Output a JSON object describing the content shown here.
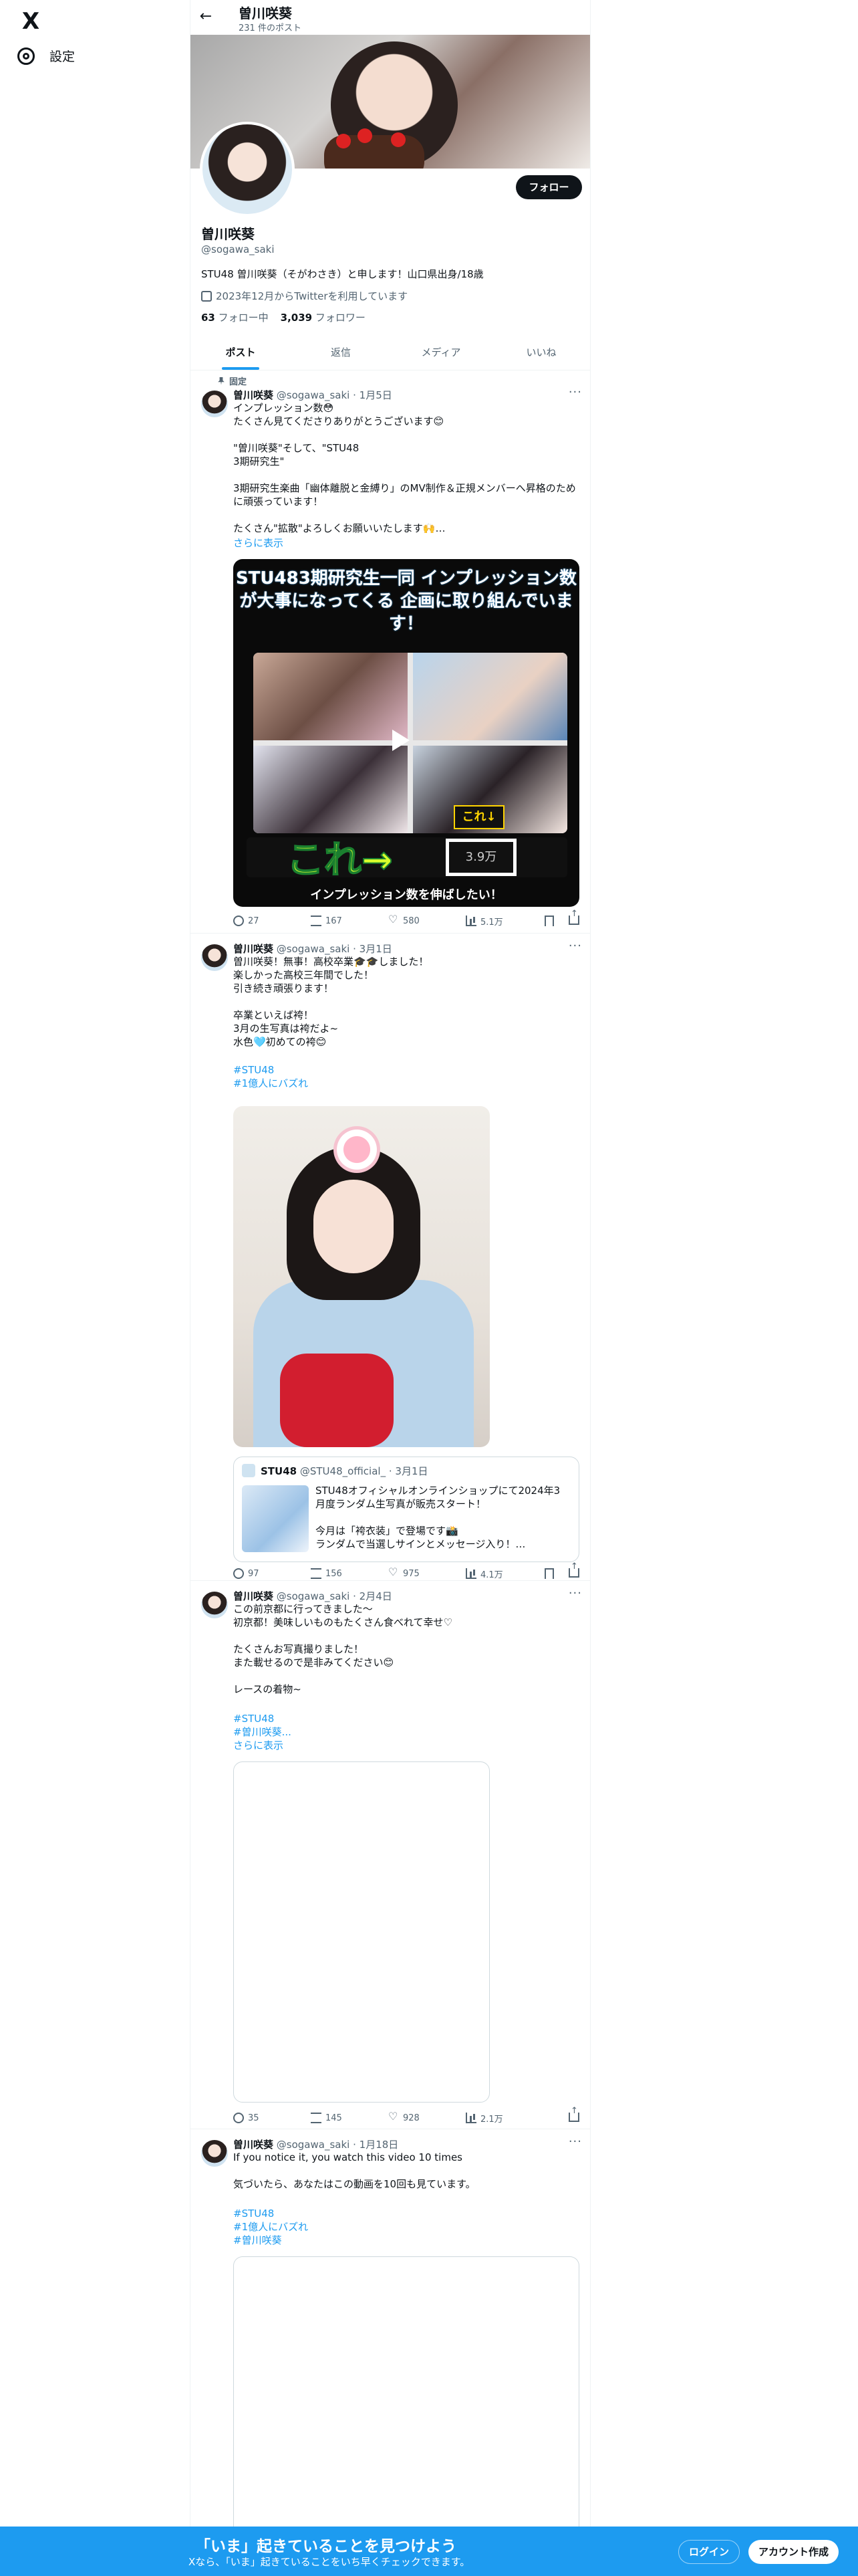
{
  "brand": {
    "logo": "X",
    "accent": "#1d9bf0"
  },
  "sidebar": {
    "settings_label": "設定"
  },
  "header": {
    "name": "曽川咲葵",
    "post_count": "231 件のポスト"
  },
  "profile": {
    "name": "曽川咲葵",
    "handle": "@sogawa_saki",
    "bio": "STU48 曽川咲葵（そがわさき）と申します！山口県出身/18歳",
    "joined": "2023年12月からTwitterを利用しています",
    "following_count": "63",
    "following_label": "フォロー中",
    "followers_count": "3,039",
    "followers_label": "フォロワー",
    "follow_button": "フォロー"
  },
  "tabs": [
    {
      "label": "ポスト"
    },
    {
      "label": "返信"
    },
    {
      "label": "メディア"
    },
    {
      "label": "いいね"
    }
  ],
  "pinned_label": "固定",
  "tweets": [
    {
      "name": "曽川咲葵",
      "handle": "@sogawa_saki",
      "date": "· 1月5日",
      "more": "···",
      "text": "インプレッション数😳\nたくさん見てくださりありがとうございます😊\n\n\"曽川咲葵\"そして、\"STU48\n3期研究生\"\n\n3期研究生楽曲「幽体離脱と金縛り」のMV制作＆正規メンバーへ昇格のために頑張っています！\n\nたくさん\"拡散\"よろしくお願いいたします🙌…",
      "show_more": "さらに表示",
      "media_title": "STU483期研究生一同\nインプレッション数が大事になってくる\n企画に取り組んでいます！",
      "media_koreru": "これ→",
      "media_kore": "これ↓",
      "media_views": "3.9万",
      "media_footer": "インプレッション数を伸ばしたい！",
      "replies": "27",
      "reposts": "167",
      "likes": "580",
      "views": "5.1万"
    },
    {
      "name": "曽川咲葵",
      "handle": "@sogawa_saki",
      "date": "· 3月1日",
      "more": "···",
      "text": "曽川咲葵！無事！高校卒業🎓🎓しました！\n楽しかった高校三年間でした！\n引き続き頑張ります！\n\n卒業といえば袴！\n3月の生写真は袴だよ~\n水色🩵初めての袴😊",
      "tags": [
        "#STU48",
        "#1億人にバズれ"
      ],
      "quote": {
        "name": "STU48",
        "handle": "@STU48_official_",
        "date": "· 3月1日",
        "text": "STU48オフィシャルオンラインショップにて2024年3月度ランダム生写真が販売スタート！\n\n今月は「袴衣装」で登場です📸\nランダムで当選しサインとメッセージ入り！…"
      },
      "replies": "97",
      "reposts": "156",
      "likes": "975",
      "views": "4.1万"
    },
    {
      "name": "曽川咲葵",
      "handle": "@sogawa_saki",
      "date": "· 2月4日",
      "more": "···",
      "text": "この前京都に行ってきました〜\n初京都！美味しいものもたくさん食べれて幸せ♡\n\nたくさんお写真撮りました！\nまた載せるので是非みてください😊\n\nレースの着物~",
      "tags": [
        "#STU48",
        "#曽川咲葵..."
      ],
      "show_more": "さらに表示",
      "replies": "35",
      "reposts": "145",
      "likes": "928",
      "views": "2.1万"
    },
    {
      "name": "曽川咲葵",
      "handle": "@sogawa_saki",
      "date": "· 1月18日",
      "more": "···",
      "text": "If you notice it, you watch this video 10 times\n\n気づいたら、あなたはこの動画を10回も見ています。",
      "tags": [
        "#STU48",
        "#1億人にバズれ",
        "#曽川咲葵"
      ]
    }
  ],
  "login_bar": {
    "title": "「いま」起きていることを見つけよう",
    "subtitle": "Xなら、「いま」起きていることをいち早くチェックできます。",
    "login": "ログイン",
    "signup": "アカウント作成"
  }
}
